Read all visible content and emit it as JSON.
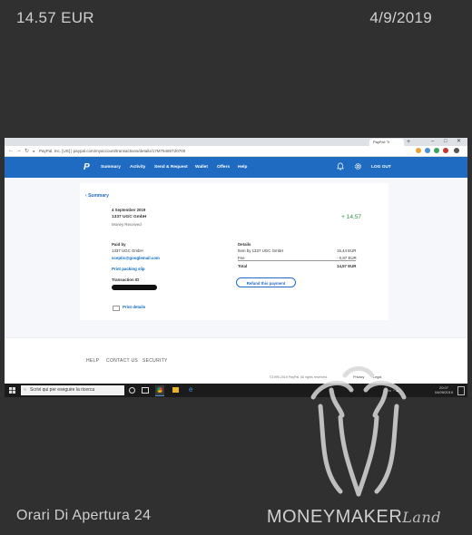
{
  "overlay": {
    "amount": "14.57 EUR",
    "date": "4/9/2019",
    "footer_left": "Orari Di Apertura 24",
    "brand_main": "MONEYMAKER",
    "brand_suffix": "Land"
  },
  "browser": {
    "tab_title": "PayPal: Tr",
    "new_tab": "+",
    "win_min": "–",
    "win_max": "□",
    "win_close": "✕",
    "url": "PayPal, Inc. [US] | paypal.com/myaccount/transactions/details/17M79485T20700"
  },
  "paypal_nav": {
    "items": [
      "Summary",
      "Activity",
      "Send & Request",
      "Wallet",
      "Offers",
      "Help"
    ],
    "logout": "LOG OUT"
  },
  "transaction": {
    "back_label": "Summary",
    "date": "4 September 2019",
    "merchant": "1337 UGC GmbH",
    "status": "Money Received",
    "amount": "+ 14,57",
    "paid_by_label": "Paid by",
    "payer_name": "1337 UGC GmbH",
    "payer_email": "sceptic@googlemail.com",
    "print_slip": "Print packing slip",
    "txid_label": "Transaction ID",
    "print_details": "Print details",
    "details_label": "Details",
    "sent_label": "Item by 1337 UGC GmbH",
    "sent_value": "15,44 EUR",
    "fee_label": "Fee",
    "fee_value": "- 0,87 EUR",
    "total_label": "Total",
    "total_value": "14,57 EUR",
    "refund_button": "Refund this payment"
  },
  "site_footer": {
    "links": [
      "HELP",
      "CONTACT US",
      "SECURITY"
    ],
    "copyright": "©1999-2019 PayPal. All rights reserved.",
    "privacy": "Privacy",
    "legal": "Legal"
  },
  "taskbar": {
    "search_placeholder": "Scrivi qui per eseguire la ricerca",
    "time": "20:07",
    "date": "04/09/2019"
  },
  "colors": {
    "paypal_blue": "#1f6bc1",
    "credit_green": "#2a8f4a",
    "background": "#303030"
  }
}
